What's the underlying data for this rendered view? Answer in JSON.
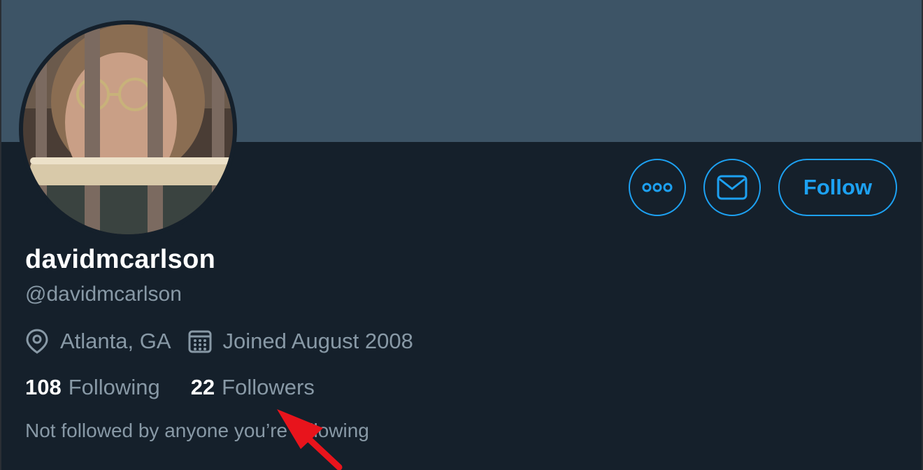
{
  "profile": {
    "display_name": "davidmcarlson",
    "handle": "@davidmcarlson",
    "location": "Atlanta, GA",
    "joined": "Joined August 2008",
    "following_count": "108",
    "following_label": "Following",
    "followers_count": "22",
    "followers_label": "Followers",
    "not_followed_text": "Not followed by anyone you’re following"
  },
  "actions": {
    "follow_label": "Follow",
    "more_icon": "more-icon",
    "message_icon": "envelope-icon"
  },
  "icons": {
    "location": "location-pin-icon",
    "calendar": "calendar-icon"
  },
  "colors": {
    "accent": "#1da1f2",
    "banner": "#3d5466",
    "background": "#15202b",
    "muted_text": "#8899a6",
    "annotation_arrow": "#e8141c"
  }
}
